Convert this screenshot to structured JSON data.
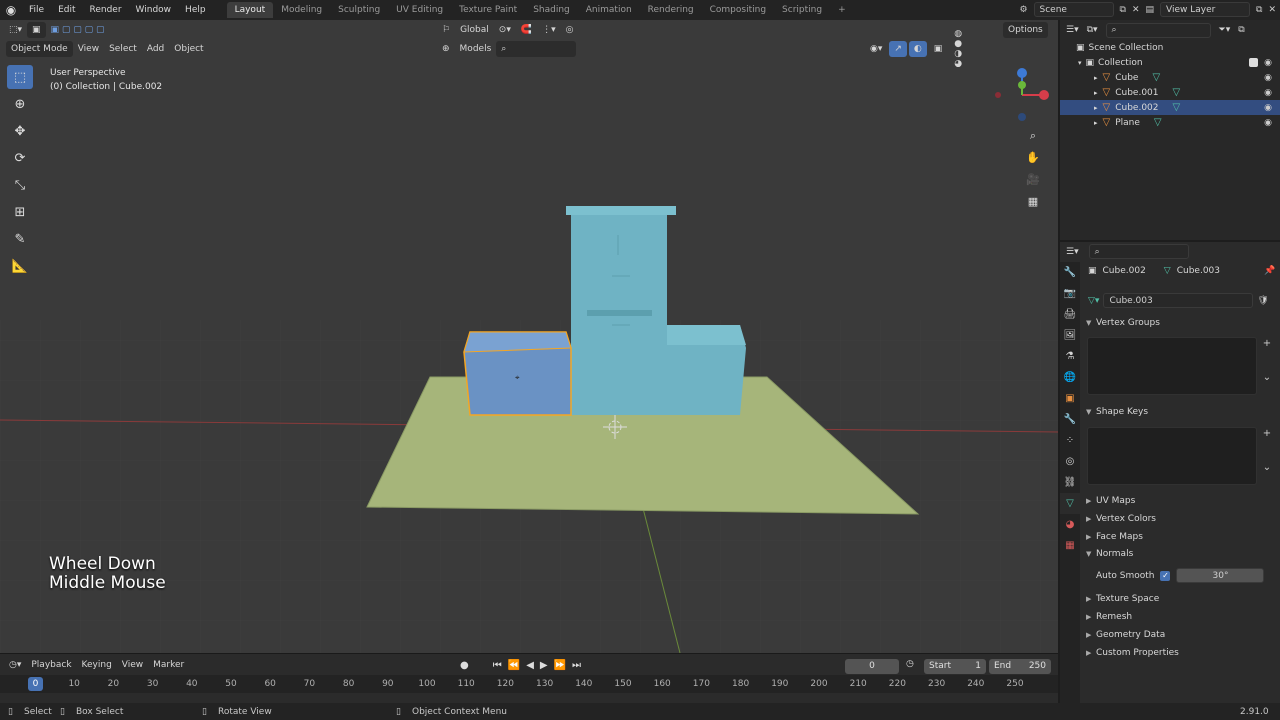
{
  "menu": {
    "items": [
      "File",
      "Edit",
      "Render",
      "Window",
      "Help"
    ],
    "tabs": [
      "Layout",
      "Modeling",
      "Sculpting",
      "UV Editing",
      "Texture Paint",
      "Shading",
      "Animation",
      "Rendering",
      "Compositing",
      "Scripting"
    ],
    "active_tab": "Layout",
    "add_tab": "+",
    "scene": "Scene",
    "view_layer": "View Layer"
  },
  "viewport": {
    "mode": "Object Mode",
    "menus": [
      "View",
      "Select",
      "Add",
      "Object"
    ],
    "orientation": "Global",
    "collection_filter": "Models",
    "options": "Options",
    "info_line1": "User Perspective",
    "info_line2": "(0) Collection | Cube.002",
    "overlay_line1": "Wheel Down",
    "overlay_line2": "Middle Mouse"
  },
  "outliner": {
    "root": "Scene Collection",
    "collection": "Collection",
    "objects": [
      {
        "name": "Cube",
        "selected": false
      },
      {
        "name": "Cube.001",
        "selected": false
      },
      {
        "name": "Cube.002",
        "selected": true
      },
      {
        "name": "Plane",
        "selected": false
      }
    ]
  },
  "properties": {
    "object_name": "Cube.002",
    "mesh_name": "Cube.003",
    "mesh_field": "Cube.003",
    "sections": {
      "vertex_groups": "Vertex Groups",
      "shape_keys": "Shape Keys",
      "uv_maps": "UV Maps",
      "vertex_colors": "Vertex Colors",
      "face_maps": "Face Maps",
      "normals": "Normals",
      "texture_space": "Texture Space",
      "remesh": "Remesh",
      "geometry_data": "Geometry Data",
      "custom_properties": "Custom Properties"
    },
    "auto_smooth_label": "Auto Smooth",
    "auto_smooth_angle": "30°"
  },
  "timeline": {
    "menus": [
      "Playback",
      "Keying",
      "View",
      "Marker"
    ],
    "current_frame": "0",
    "start_label": "Start",
    "start": "1",
    "end_label": "End",
    "end": "250",
    "ruler": [
      "0",
      "10",
      "20",
      "30",
      "40",
      "50",
      "60",
      "70",
      "80",
      "90",
      "100",
      "110",
      "120",
      "130",
      "140",
      "150",
      "160",
      "170",
      "180",
      "190",
      "200",
      "210",
      "220",
      "230",
      "240",
      "250"
    ]
  },
  "status": {
    "select": "Select",
    "box_select": "Box Select",
    "rotate_view": "Rotate View",
    "context_menu": "Object Context Menu",
    "version": "2.91.0"
  },
  "colors": {
    "accent": "#4772b3",
    "selected_object": "#f5a623",
    "mesh_blue": "#6fb3c4",
    "plane_green": "#a6b57a"
  }
}
